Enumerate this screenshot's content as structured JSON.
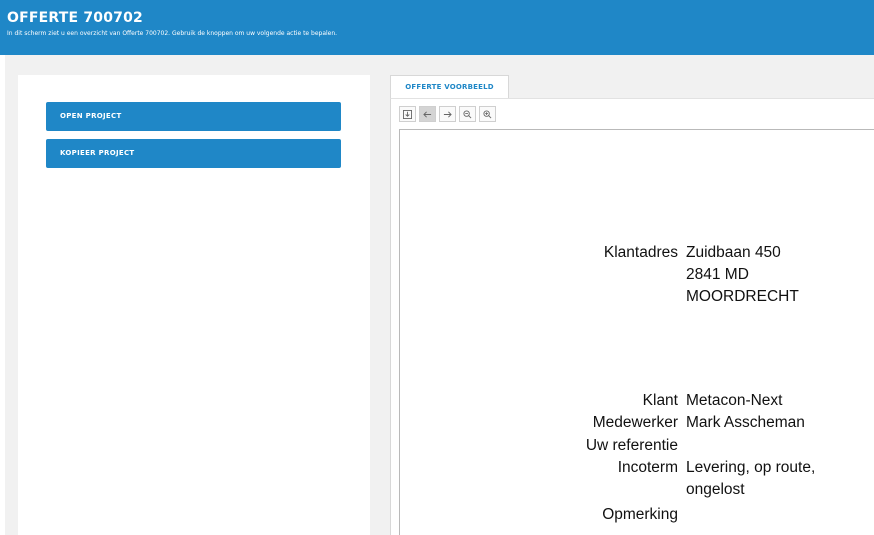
{
  "header": {
    "title": "OFFERTE 700702",
    "subtitle": "In dit scherm ziet u een overzicht van Offerte 700702. Gebruik de knoppen om uw volgende actie te bepalen."
  },
  "actions": {
    "open_project": "OPEN PROJECT",
    "copy_project": "KOPIEER PROJECT"
  },
  "preview": {
    "tab_label": "OFFERTE VOORBEELD",
    "toolbar": [
      "download-icon",
      "arrow-left-icon",
      "arrow-right-icon",
      "zoom-out-icon",
      "zoom-in-icon"
    ],
    "document": {
      "address_label": "Klantadres",
      "address_lines": [
        "Zuidbaan 450",
        "2841 MD",
        "MOORDRECHT"
      ],
      "customer_label": "Klant",
      "customer_value": "Metacon-Next",
      "employee_label": "Medewerker",
      "employee_value": "Mark Asscheman",
      "reference_label": "Uw referentie",
      "reference_value": "",
      "incoterm_label": "Incoterm",
      "incoterm_lines": [
        "Levering, op route,",
        "ongelost"
      ],
      "remark_label": "Opmerking",
      "remark_value": ""
    }
  },
  "colors": {
    "brand": "#1f87c7",
    "background": "#f1f1f1"
  }
}
